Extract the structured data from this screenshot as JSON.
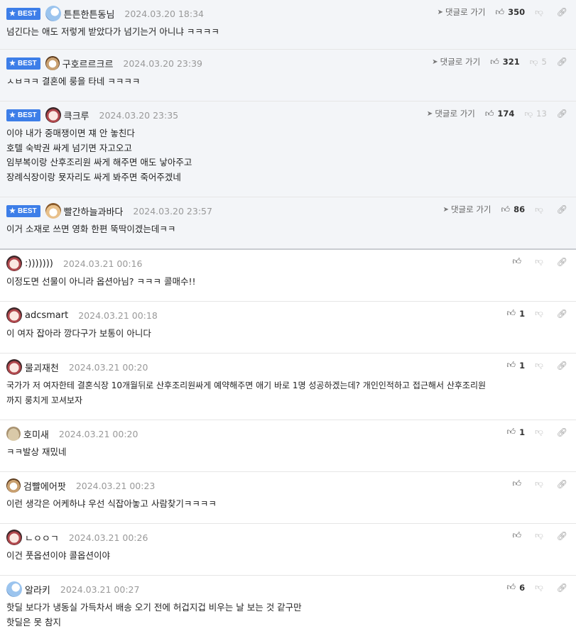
{
  "labels": {
    "best": "BEST",
    "reply": "댓글로 가기"
  },
  "icons": {
    "best": "star-icon",
    "reply": "arrow-icon",
    "up": "thumbs-up-icon",
    "down": "thumbs-down-icon",
    "link": "link-icon"
  },
  "comments": [
    {
      "nick": "튼튼한튼동님",
      "date": "2024.03.20 18:34",
      "up": "350",
      "down": "",
      "lines": [
        "넘긴다는 애도 저렇게 받았다가 넘기는거 아니냐 ㅋㅋㅋㅋ"
      ]
    },
    {
      "nick": "구호르르크르",
      "date": "2024.03.20 23:39",
      "up": "321",
      "down": "5",
      "lines": [
        "ㅅㅂㅋㅋ 결혼에 룽을 타네 ㅋㅋㅋㅋ"
      ]
    },
    {
      "nick": "큭크루",
      "date": "2024.03.20 23:35",
      "up": "174",
      "down": "13",
      "lines": [
        "이야 내가 중매쟁이면 쟤 안 놓친다",
        "호텔 숙박권 싸게 넘기면 자고오고",
        "임부복이랑 산후조리원 싸게 해주면 애도 낳아주고",
        "장례식장이랑 묫자리도 싸게 봐주면 죽어주겠네"
      ]
    },
    {
      "nick": "빨간하늘과바다",
      "date": "2024.03.20 23:57",
      "up": "86",
      "down": "",
      "lines": [
        "이거 소재로 쓰면 영화 한편 뚝딱이겠는데ㅋㅋ"
      ]
    },
    {
      "nick": ":)))))))",
      "date": "2024.03.21 00:16",
      "up": "",
      "down": "",
      "lines": [
        "이정도면 선물이 아니라 옵션아님? ㅋㅋㅋ 콜매수!!"
      ]
    },
    {
      "nick": "adcsmart",
      "date": "2024.03.21 00:18",
      "up": "1",
      "down": "",
      "lines": [
        "이 여자 잡아라 깡다구가 보통이 아니다"
      ]
    },
    {
      "nick": "물괴재천",
      "date": "2024.03.21 00:20",
      "up": "1",
      "down": "",
      "lines": [
        "국가가 저 여자한테 결혼식장 10개월뒤로 산후조리원싸게 예약해주면 애기 바로 1명 성공하겠는데? 개인인적하고 접근해서 산후조리원",
        "까지 룽치게 꼬셔보자"
      ]
    },
    {
      "nick": "호미새",
      "date": "2024.03.21 00:20",
      "up": "1",
      "down": "",
      "lines": [
        "ㅋㅋ발상 재밌네"
      ]
    },
    {
      "nick": "검빨에어팟",
      "date": "2024.03.21 00:23",
      "up": "",
      "down": "",
      "lines": [
        "이런 생각은 어케하냐 우선 식잡아놓고 사람찾기ㅋㅋㅋㅋ"
      ]
    },
    {
      "nick": "ㄴㅇㅇㄱ",
      "date": "2024.03.21 00:26",
      "up": "",
      "down": "",
      "lines": [
        "이건 풋옵션이야 콜옵션이야"
      ]
    },
    {
      "nick": "알라키",
      "date": "2024.03.21 00:27",
      "up": "6",
      "down": "",
      "lines": [
        "핫딜 보다가 냉동실 가득차서 배송 오기 전에 허겁지겁 비우는 날 보는 것 같구만",
        "핫딜은 못 참지"
      ]
    }
  ]
}
